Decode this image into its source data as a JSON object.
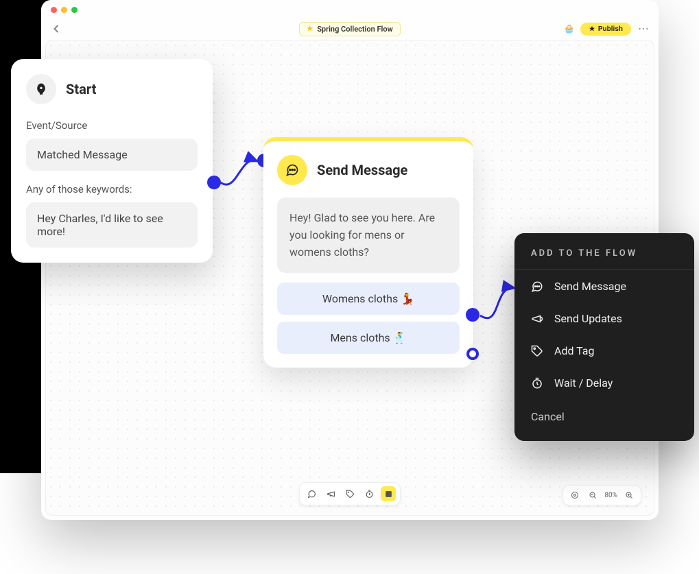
{
  "header": {
    "flow_title": "Spring Collection Flow",
    "publish_label": "Publish",
    "zoom_level": "80%"
  },
  "start_card": {
    "title": "Start",
    "event_label": "Event/Source",
    "event_value": "Matched Message",
    "keywords_label": "Any of those keywords:",
    "keywords_value": "Hey Charles, I'd like to see more!"
  },
  "send_card": {
    "title": "Send Message",
    "message_text": "Hey! Glad to see you here. Are you looking for mens or womens cloths?",
    "choice_a": "Womens cloths 💃",
    "choice_b": "Mens cloths 🕺"
  },
  "context_menu": {
    "title": "ADD TO THE FLOW",
    "items": [
      {
        "icon": "chat",
        "label": "Send Message"
      },
      {
        "icon": "megaphone",
        "label": "Send Updates"
      },
      {
        "icon": "tag",
        "label": "Add Tag"
      },
      {
        "icon": "timer",
        "label": "Wait / Delay"
      }
    ],
    "cancel_label": "Cancel"
  },
  "bottom_tools": {
    "icons": [
      "chat",
      "megaphone",
      "tag",
      "timer",
      "note"
    ]
  }
}
